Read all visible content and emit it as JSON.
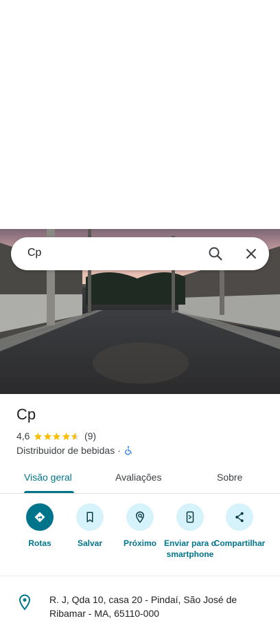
{
  "search": {
    "query": "Cp"
  },
  "place": {
    "name": "Cp",
    "rating": "4,6",
    "stars": 4.6,
    "review_count": "(9)",
    "category": "Distribuidor de bebidas",
    "separator": "·"
  },
  "tabs": [
    {
      "label": "Visão geral",
      "active": true
    },
    {
      "label": "Avaliações",
      "active": false
    },
    {
      "label": "Sobre",
      "active": false
    }
  ],
  "actions": [
    {
      "label": "Rotas",
      "icon": "directions-icon"
    },
    {
      "label": "Salvar",
      "icon": "bookmark-icon"
    },
    {
      "label": "Próximo",
      "icon": "nearby-icon"
    },
    {
      "label": "Enviar para o smartphone",
      "icon": "send-to-phone-icon"
    },
    {
      "label": "Compartilhar",
      "icon": "share-icon"
    }
  ],
  "address": {
    "text": "R. J, Qda 10, casa 20 - Pindaí, São José de Ribamar - MA, 65110-000"
  },
  "colors": {
    "accent": "#00748a",
    "accent_light": "#d6f3fb",
    "star": "#fbbc04"
  }
}
